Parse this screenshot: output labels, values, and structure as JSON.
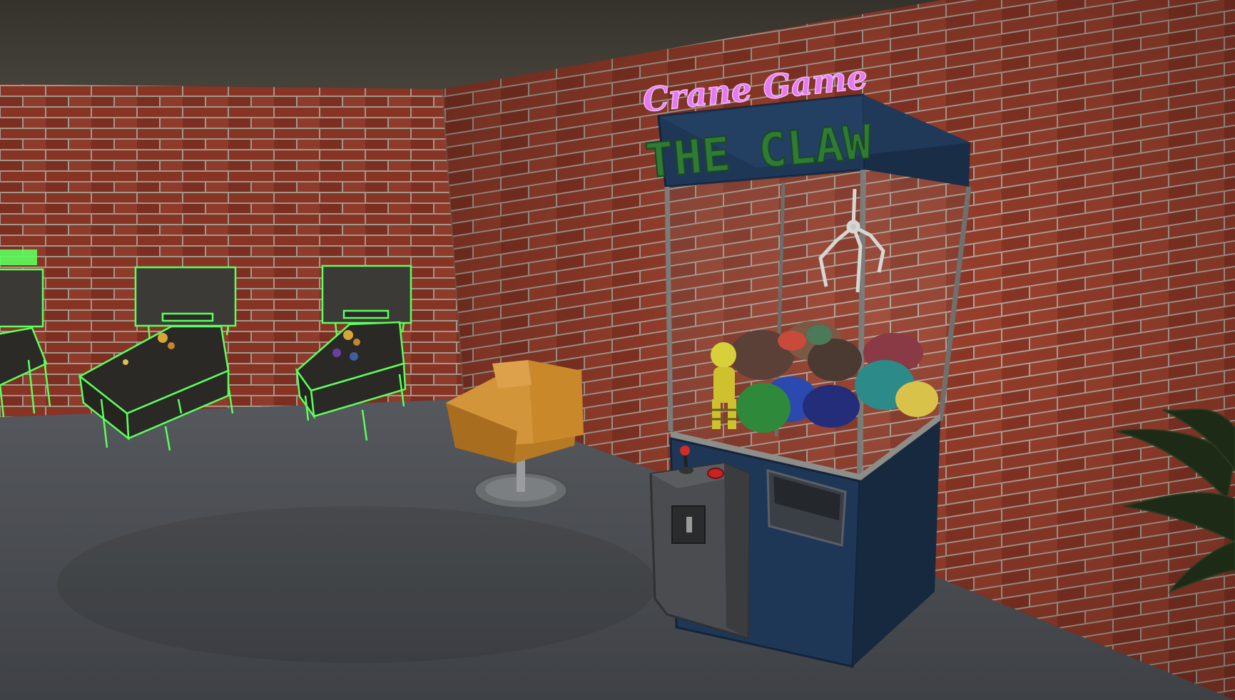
{
  "scene": {
    "colors": {
      "ceiling": "#3d3b33",
      "brick": "#9a3f2d",
      "mortar": "#b9b2a6",
      "floor": "#4b4e52",
      "neon_green": "#5cff5c",
      "neon_pink": "#e27af0",
      "cabinet_blue": "#1f3757",
      "sign_text_green": "#2f7a35",
      "chair_orange": "#c9892b"
    }
  },
  "claw_machine": {
    "neon_sign": "Crane Game",
    "title": "THE CLAW"
  },
  "pinball_machines": [
    {
      "name": "pinball-left-cut",
      "icon": "pinball-machine"
    },
    {
      "name": "pinball-middle",
      "icon": "pinball-machine"
    },
    {
      "name": "pinball-right",
      "icon": "pinball-machine"
    }
  ]
}
